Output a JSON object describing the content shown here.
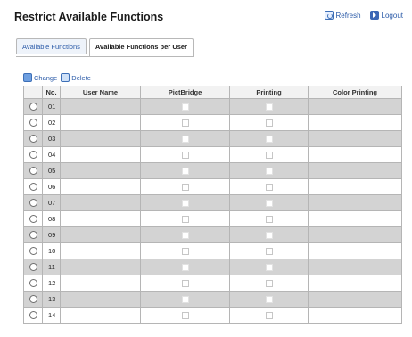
{
  "header": {
    "title": "Restrict Available Functions",
    "refresh_label": "Refresh",
    "logout_label": "Logout"
  },
  "tabs": [
    {
      "label": "Available Functions",
      "active": false
    },
    {
      "label": "Available Functions per User",
      "active": true
    }
  ],
  "actions": {
    "change_label": "Change",
    "delete_label": "Delete"
  },
  "table": {
    "columns": [
      "",
      "No.",
      "User Name",
      "PictBridge",
      "Printing",
      "Color Printing"
    ],
    "rows": [
      {
        "no": "01",
        "user_name": "",
        "pictbridge": false,
        "printing": false
      },
      {
        "no": "02",
        "user_name": "",
        "pictbridge": false,
        "printing": false
      },
      {
        "no": "03",
        "user_name": "",
        "pictbridge": false,
        "printing": false
      },
      {
        "no": "04",
        "user_name": "",
        "pictbridge": false,
        "printing": false
      },
      {
        "no": "05",
        "user_name": "",
        "pictbridge": false,
        "printing": false
      },
      {
        "no": "06",
        "user_name": "",
        "pictbridge": false,
        "printing": false
      },
      {
        "no": "07",
        "user_name": "",
        "pictbridge": false,
        "printing": false
      },
      {
        "no": "08",
        "user_name": "",
        "pictbridge": false,
        "printing": false
      },
      {
        "no": "09",
        "user_name": "",
        "pictbridge": false,
        "printing": false
      },
      {
        "no": "10",
        "user_name": "",
        "pictbridge": false,
        "printing": false
      },
      {
        "no": "11",
        "user_name": "",
        "pictbridge": false,
        "printing": false
      },
      {
        "no": "12",
        "user_name": "",
        "pictbridge": false,
        "printing": false
      },
      {
        "no": "13",
        "user_name": "",
        "pictbridge": false,
        "printing": false
      },
      {
        "no": "14",
        "user_name": "",
        "pictbridge": false,
        "printing": false
      }
    ]
  },
  "colors": {
    "link": "#2a5aa8",
    "row_shade": "#d3d3d3",
    "border": "#b5b5b5"
  }
}
